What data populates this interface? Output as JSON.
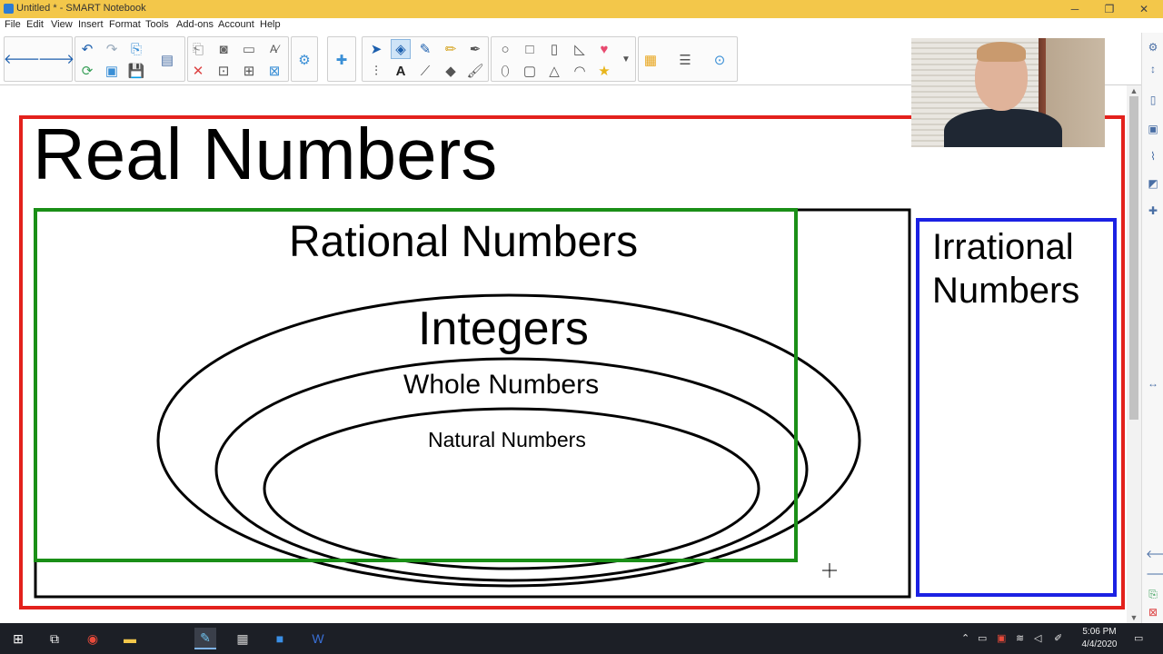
{
  "window": {
    "title": "Untitled * - SMART Notebook",
    "minimize": "─",
    "maximize": "❐",
    "close": "✕"
  },
  "menu": [
    "File",
    "Edit",
    "View",
    "Insert",
    "Format",
    "Tools",
    "Add-ons",
    "Account",
    "Help"
  ],
  "diagram": {
    "real": "Real Numbers",
    "rational": "Rational Numbers",
    "integers": "Integers",
    "whole": "Whole Numbers",
    "natural": "Natural Numbers",
    "irrational_line1": "Irrational",
    "irrational_line2": "Numbers",
    "colors": {
      "real_border": "#e3211c",
      "rational_border": "#1a8f17",
      "irrational_border": "#1b21e3",
      "outline": "#000000"
    }
  },
  "taskbar": {
    "time": "5:06 PM",
    "date": "4/4/2020"
  }
}
